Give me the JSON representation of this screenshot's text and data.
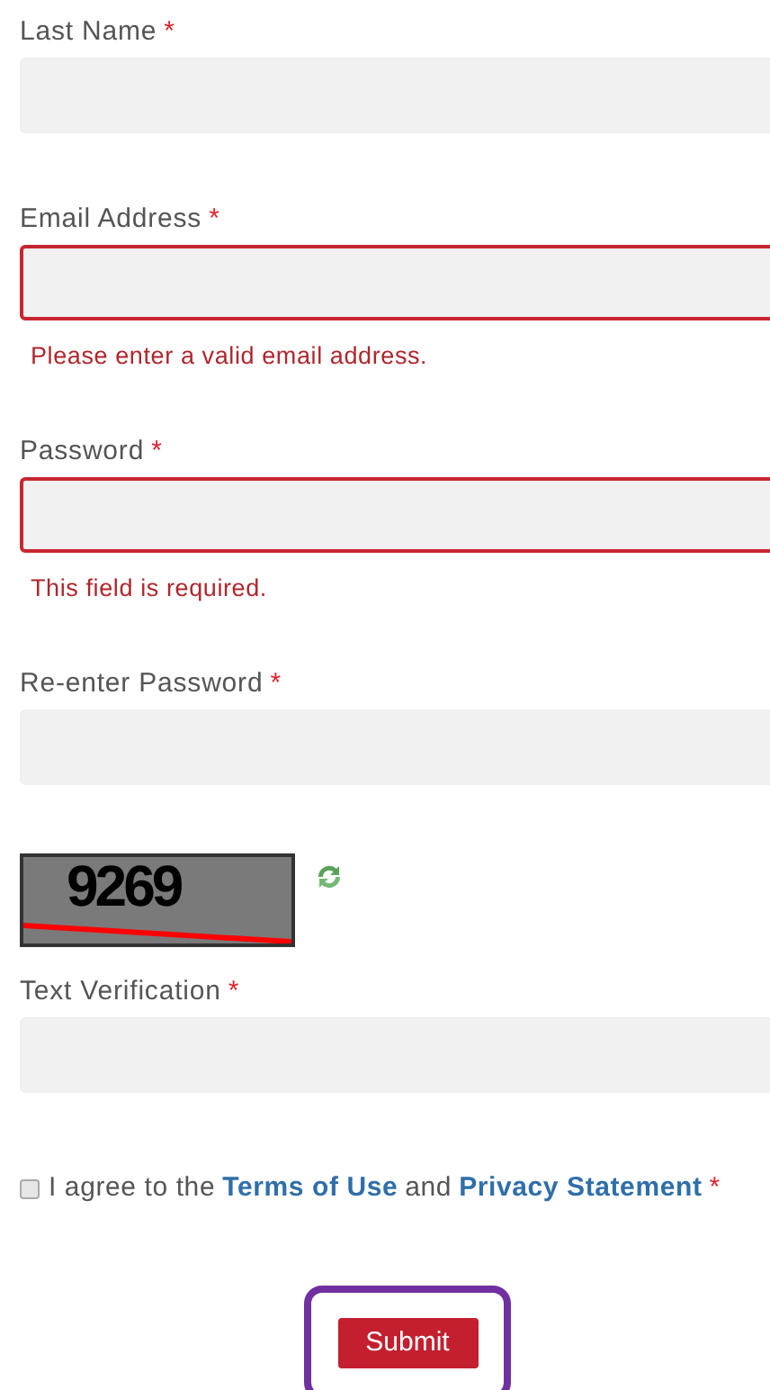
{
  "form_items": [
    {
      "kind": "field",
      "label": "Last Name",
      "required_mark": "*",
      "invalid": false
    },
    {
      "kind": "field",
      "label": "Email Address",
      "required_mark": "*",
      "invalid": true,
      "error": "Please enter a valid email address."
    },
    {
      "kind": "field",
      "label": "Password",
      "required_mark": "*",
      "invalid": true,
      "error": "This field is required."
    },
    {
      "kind": "field",
      "label": "Re-enter Password",
      "required_mark": "*",
      "invalid": false
    },
    {
      "kind": "captcha",
      "code": "9269"
    },
    {
      "kind": "field",
      "label": "Text Verification",
      "required_mark": "*",
      "invalid": false
    }
  ],
  "agreement": {
    "checked": false,
    "prefix": "I agree to the",
    "link_1": "Terms of Use",
    "middle": "and",
    "link_2": "Privacy Statement",
    "required_mark": "*"
  },
  "submit": {
    "label": "Submit",
    "highlighted": true
  }
}
